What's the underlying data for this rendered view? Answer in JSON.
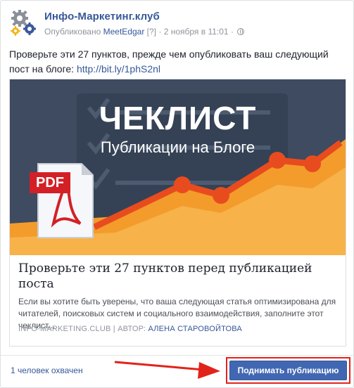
{
  "post": {
    "page_name": "Инфо-Маркетинг.клуб",
    "published_prefix": "Опубликовано",
    "published_via": "MeetEdgar",
    "help_mark": "[?]",
    "separator": "·",
    "date": "2 ноября в 11:01",
    "separator2": "·",
    "text": "Проверьте эти 27 пунктов, прежде чем опубликовать ваш следующий пост на блоге:",
    "url": "http://bit.ly/1phS2nl"
  },
  "preview": {
    "image_title": "ЧЕКЛИСТ",
    "image_subtitle": "Публикации на Блоге",
    "pdf_label": "PDF",
    "title": "Проверьте эти 27 пунктов перед публикацией поста",
    "description": "Если вы хотите быть уверены, что ваша следующая статья оптимизирована для читателей, поисковых систем и социального взаимодействия, заполните этот чеклист...",
    "domain": "INFO-MARKETING.CLUB",
    "author_prefix": "| АВТОР:",
    "author": "АЛЕНА СТАРОВОЙТОВА"
  },
  "footer": {
    "reach": "1 человек охвачен",
    "boost_label": "Поднимать публикацию"
  },
  "colors": {
    "link": "#365899",
    "button": "#4267b2",
    "highlight": "#e2231a",
    "image_bg": "#3c4a5e",
    "image_accent": "#f39c2b"
  },
  "icons": {
    "avatar": "gears-logo-icon",
    "privacy": "globe-icon",
    "pdf": "pdf-document-icon",
    "annotation": "red-arrow-icon"
  }
}
